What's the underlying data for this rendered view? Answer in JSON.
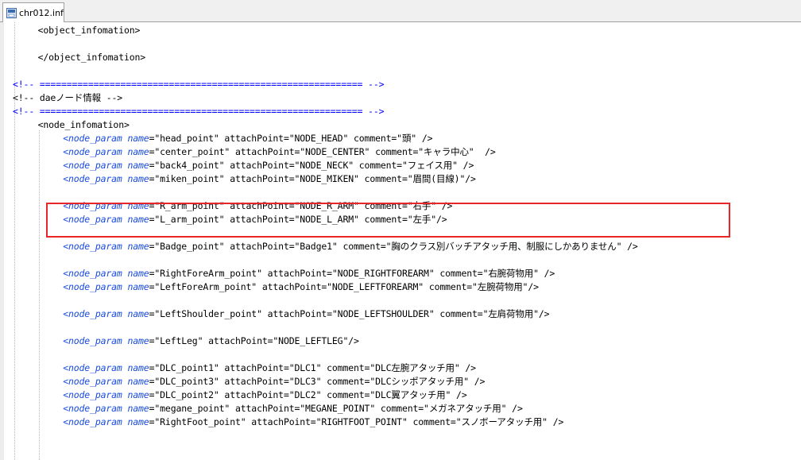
{
  "tab": {
    "file_name": "chr012.inf",
    "icon": "file-icon"
  },
  "highlight": {
    "color": "#e8262a",
    "line": "Badge_point"
  },
  "lines": [
    {
      "indent": 4,
      "kind": "text",
      "text": "<object_infomation>"
    },
    {
      "kind": "blank"
    },
    {
      "indent": 4,
      "kind": "text",
      "text": "</object_infomation>"
    },
    {
      "kind": "blank"
    },
    {
      "indent": 0,
      "kind": "comment",
      "text": "<!-- ============================================================ -->"
    },
    {
      "indent": 0,
      "kind": "text",
      "text": "<!-- daeノード情報 -->"
    },
    {
      "indent": 0,
      "kind": "comment",
      "text": "<!-- ============================================================ -->"
    },
    {
      "indent": 4,
      "kind": "text",
      "text": "<node_infomation>"
    },
    {
      "indent": 8,
      "kind": "node",
      "rest": "\"head_point\" attachPoint=\"NODE_HEAD\" comment=\"頭\" />"
    },
    {
      "indent": 8,
      "kind": "node",
      "rest": "\"center_point\" attachPoint=\"NODE_CENTER\" comment=\"キャラ中心\"  />"
    },
    {
      "indent": 8,
      "kind": "node",
      "rest": "\"back4_point\" attachPoint=\"NODE_NECK\" comment=\"フェイス用\" />"
    },
    {
      "indent": 8,
      "kind": "node",
      "rest": "\"miken_point\" attachPoint=\"NODE_MIKEN\" comment=\"眉間(目線)\"/>"
    },
    {
      "kind": "blank"
    },
    {
      "indent": 8,
      "kind": "node",
      "rest": "\"R_arm_point\" attachPoint=\"NODE_R_ARM\" comment=\"右手\" />"
    },
    {
      "indent": 8,
      "kind": "node",
      "rest": "\"L_arm_point\" attachPoint=\"NODE_L_ARM\" comment=\"左手\"/>"
    },
    {
      "kind": "blank"
    },
    {
      "indent": 8,
      "kind": "node",
      "rest": "\"Badge_point\" attachPoint=\"Badge1\" comment=\"胸のクラス別バッチアタッチ用、制服にしかありません\" />"
    },
    {
      "kind": "blank"
    },
    {
      "indent": 8,
      "kind": "node",
      "rest": "\"RightForeArm_point\" attachPoint=\"NODE_RIGHTFOREARM\" comment=\"右腕荷物用\" />"
    },
    {
      "indent": 8,
      "kind": "node",
      "rest": "\"LeftForeArm_point\" attachPoint=\"NODE_LEFTFOREARM\" comment=\"左腕荷物用\"/>"
    },
    {
      "kind": "blank"
    },
    {
      "indent": 8,
      "kind": "node",
      "rest": "\"LeftShoulder_point\" attachPoint=\"NODE_LEFTSHOULDER\" comment=\"左肩荷物用\"/>"
    },
    {
      "kind": "blank"
    },
    {
      "indent": 8,
      "kind": "node",
      "rest": "\"LeftLeg\" attachPoint=\"NODE_LEFTLEG\"/>"
    },
    {
      "kind": "blank"
    },
    {
      "indent": 8,
      "kind": "node",
      "rest": "\"DLC_point1\" attachPoint=\"DLC1\" comment=\"DLC左腕アタッチ用\" />"
    },
    {
      "indent": 8,
      "kind": "node",
      "rest": "\"DLC_point3\" attachPoint=\"DLC3\" comment=\"DLCシッポアタッチ用\" />"
    },
    {
      "indent": 8,
      "kind": "node",
      "rest": "\"DLC_point2\" attachPoint=\"DLC2\" comment=\"DLC翼アタッチ用\" />"
    },
    {
      "indent": 8,
      "kind": "node",
      "rest": "\"megane_point\" attachPoint=\"MEGANE_POINT\" comment=\"メガネアタッチ用\" />"
    },
    {
      "indent": 8,
      "kind": "node",
      "rest": "\"RightFoot_point\" attachPoint=\"RIGHTFOOT_POINT\" comment=\"スノボーアタッチ用\" />"
    }
  ],
  "node_tag": "<node_param",
  "node_attr": "name",
  "colors": {
    "comment": "#0000ff",
    "keyword": "#1a4ce0",
    "text": "#000000",
    "background": "#ffffff"
  }
}
